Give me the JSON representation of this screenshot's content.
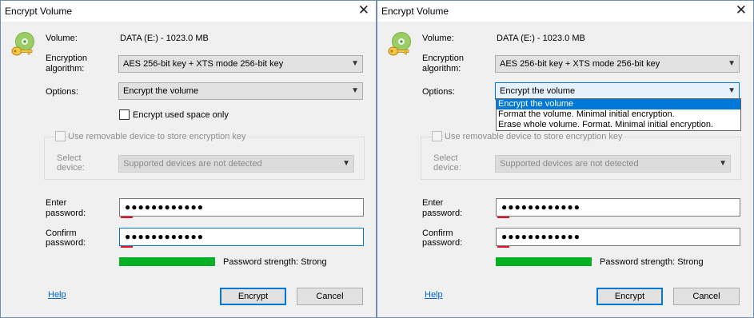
{
  "colors": {
    "accent": "#0078d7",
    "strength_bar": "#06b025",
    "password_hint_line": "#e81123",
    "link": "#0066cc"
  },
  "icons": {
    "app": "disk-with-key-icon",
    "close": "close-icon",
    "combo_arrow": "chevron-down-icon"
  },
  "windows": [
    {
      "title": "Encrypt Volume",
      "volume_label": "Volume:",
      "volume_value": "DATA (E:) - 1023.0 MB",
      "algorithm_label_1": "Encryption",
      "algorithm_label_2": "algorithm:",
      "algorithm_value": "AES 256-bit key + XTS mode 256-bit key",
      "options_label": "Options:",
      "options_value": "Encrypt the volume",
      "options_open": false,
      "encrypt_used_space_label": "Encrypt used space only",
      "encrypt_used_space_checked": false,
      "removable_label": "Use removable device to store encryption key",
      "removable_checked": false,
      "removable_enabled": false,
      "select_device_label_1": "Select",
      "select_device_label_2": "device:",
      "select_device_value": "Supported devices are not detected",
      "enter_password_label_1": "Enter",
      "enter_password_label_2": "password:",
      "enter_password_value": "●●●●●●●●●●●●",
      "confirm_password_label_1": "Confirm",
      "confirm_password_label_2": "password:",
      "confirm_password_value": "●●●●●●●●●●●●",
      "strength_text": "Password strength: Strong",
      "help_label": "Help",
      "encrypt_label": "Encrypt",
      "cancel_label": "Cancel"
    },
    {
      "title": "Encrypt Volume",
      "volume_label": "Volume:",
      "volume_value": "DATA (E:) - 1023.0 MB",
      "algorithm_label_1": "Encryption",
      "algorithm_label_2": "algorithm:",
      "algorithm_value": "AES 256-bit key + XTS mode 256-bit key",
      "options_label": "Options:",
      "options_value": "Encrypt the volume",
      "options_open": true,
      "options_list": [
        "Encrypt the volume",
        "Format the volume. Minimal initial encryption.",
        "Erase whole volume. Format. Minimal initial encryption."
      ],
      "options_selected_index": 0,
      "removable_label": "Use removable device to store encryption key",
      "removable_checked": false,
      "removable_enabled": false,
      "select_device_label_1": "Select",
      "select_device_label_2": "device:",
      "select_device_value": "Supported devices are not detected",
      "enter_password_label_1": "Enter",
      "enter_password_label_2": "password:",
      "enter_password_value": "●●●●●●●●●●●●",
      "confirm_password_label_1": "Confirm",
      "confirm_password_label_2": "password:",
      "confirm_password_value": "●●●●●●●●●●●●",
      "strength_text": "Password strength: Strong",
      "help_label": "Help",
      "encrypt_label": "Encrypt",
      "cancel_label": "Cancel"
    }
  ]
}
